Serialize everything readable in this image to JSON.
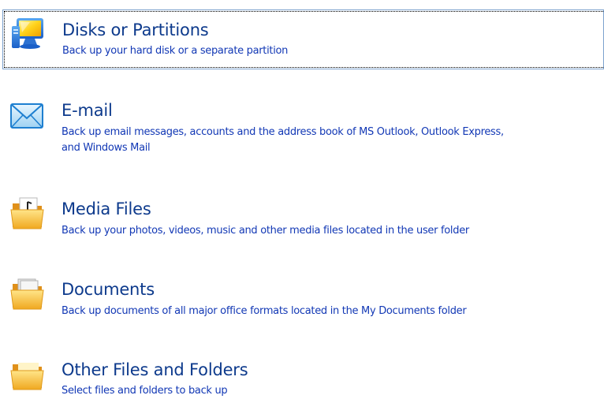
{
  "items": [
    {
      "title": "Disks or Partitions",
      "description": "Back up your hard disk or a separate partition",
      "icon": "computer-monitor-icon",
      "selected": true
    },
    {
      "title": "E-mail",
      "description": "Back up email messages, accounts and the address book of MS Outlook, Outlook Express,",
      "description_line2": "and Windows Mail",
      "icon": "envelope-icon",
      "selected": false
    },
    {
      "title": "Media Files",
      "description": "Back up your photos, videos, music and other media files located in the user folder",
      "icon": "media-folder-icon",
      "selected": false
    },
    {
      "title": "Documents",
      "description": "Back up documents of all major office formats located in the My Documents folder",
      "icon": "documents-folder-icon",
      "selected": false
    },
    {
      "title": "Other Files and Folders",
      "description": "Select files and folders to back up",
      "icon": "folder-icon",
      "selected": false
    }
  ],
  "colors": {
    "title": "#0d3a8c",
    "description": "#1238b5",
    "selection_border": "#7da2ce"
  }
}
